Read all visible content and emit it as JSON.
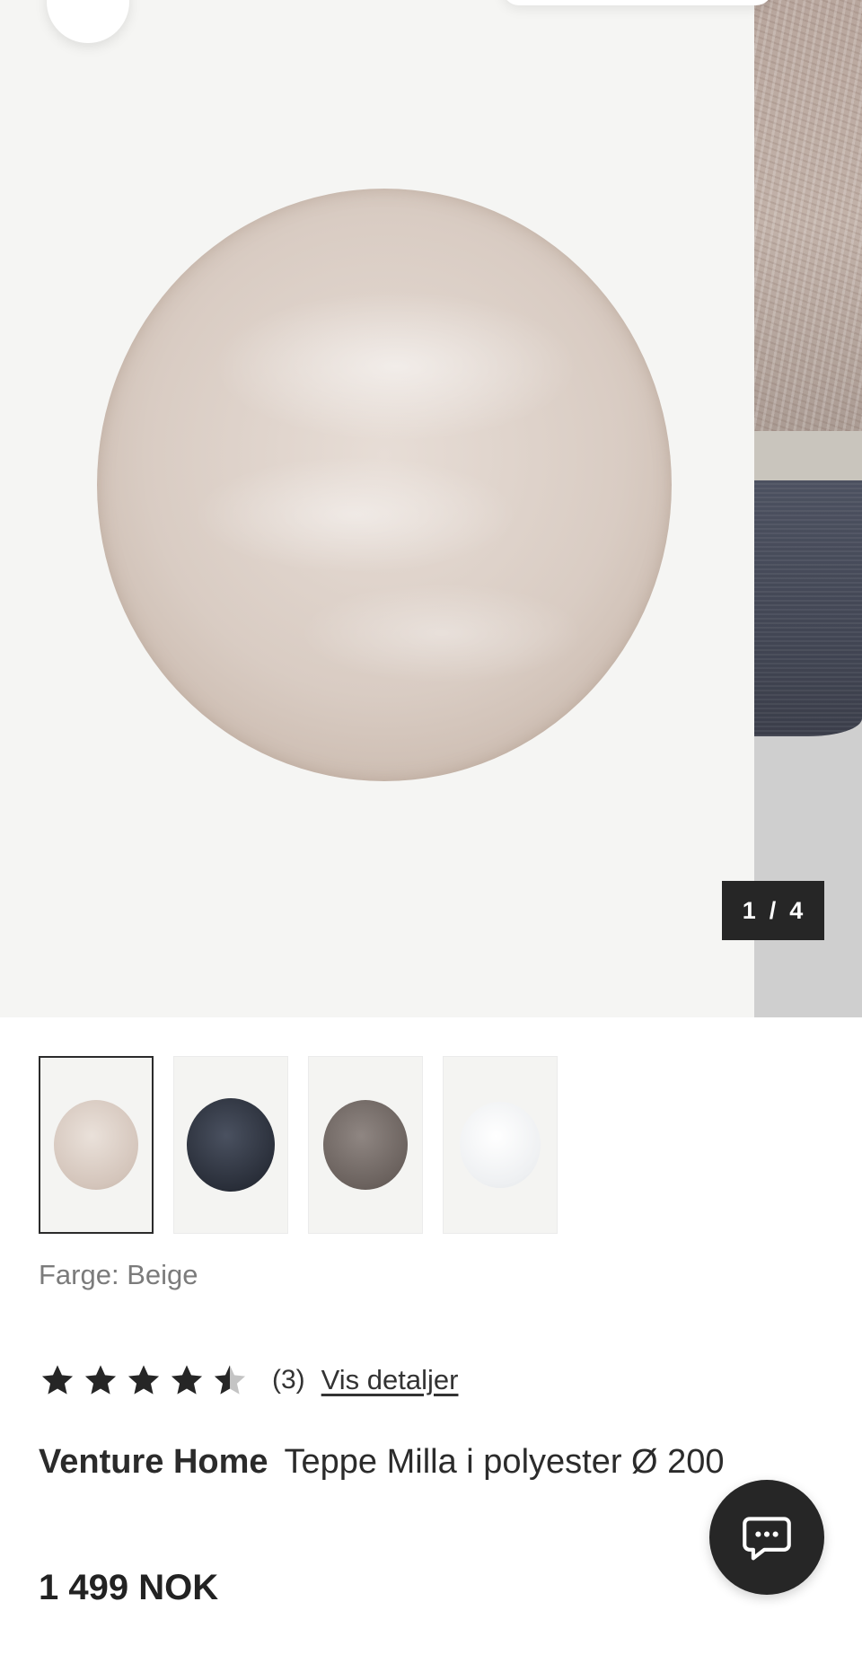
{
  "gallery": {
    "counter_current": "1",
    "counter_separator": "/",
    "counter_total": "4"
  },
  "thumbnails": [
    {
      "color": "Beige",
      "swatch": "#d9ccc3",
      "selected": true
    },
    {
      "color": "Navy",
      "swatch": "#2a2f3a",
      "selected": false
    },
    {
      "color": "Taupe",
      "swatch": "#6b625e",
      "selected": false
    },
    {
      "color": "White",
      "swatch": "#eef0f2",
      "selected": false
    }
  ],
  "product": {
    "color_label": "Farge: Beige",
    "rating": 4.5,
    "rating_max": 5,
    "review_count": "(3)",
    "details_link": "Vis detaljer",
    "brand": "Venture Home",
    "name": "Teppe Milla i polyester Ø 200",
    "price": "1 499 NOK"
  },
  "icons": {
    "star": "star-icon",
    "chat": "chat-bubble-icon"
  },
  "colors": {
    "dark": "#262626",
    "background": "#f5f5f3",
    "muted_text": "#7b7b7b"
  }
}
